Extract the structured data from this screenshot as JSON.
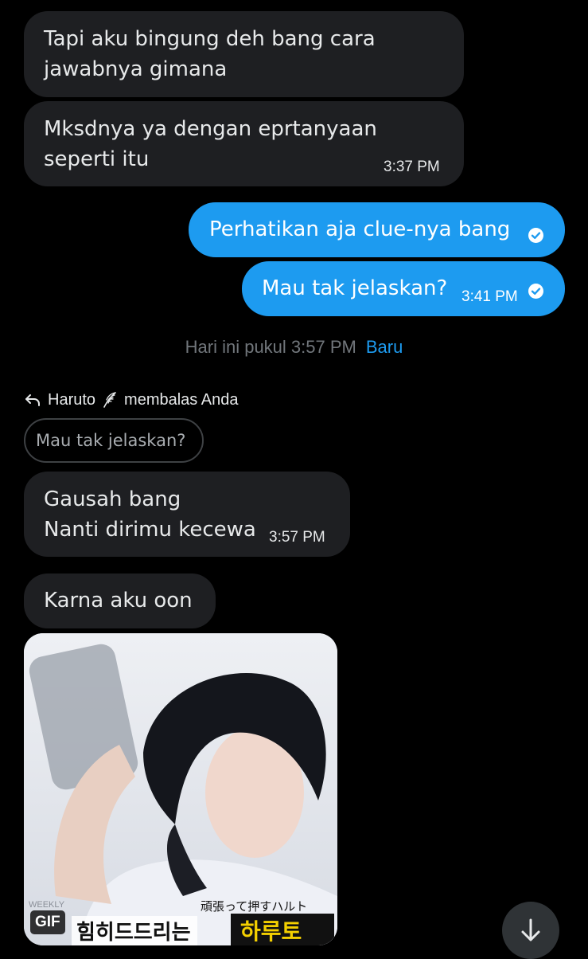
{
  "messages": [
    {
      "direction": "incoming",
      "lines": [
        "Tapi aku bingung deh bang cara",
        "jawabnya gimana"
      ],
      "time": ""
    },
    {
      "direction": "incoming",
      "lines": [
        "Mksdnya ya dengan eprtanyaan",
        "seperti itu"
      ],
      "time": "3:37 PM"
    },
    {
      "direction": "outgoing",
      "lines": [
        "Perhatikan aja clue-nya bang"
      ],
      "time": "",
      "status": "check-icon"
    },
    {
      "direction": "outgoing",
      "lines": [
        "Mau tak jelaskan?"
      ],
      "time": "3:41 PM",
      "status": "check-icon"
    },
    {
      "direction": "incoming",
      "lines": [
        "Gausah bang",
        "Nanti dirimu kecewa"
      ],
      "time": "3:57 PM"
    },
    {
      "direction": "incoming",
      "lines": [
        "Karna aku oon"
      ],
      "time": ""
    }
  ],
  "separator": {
    "text": "Hari ini pukul 3:57 PM",
    "new_label": "Baru"
  },
  "reply": {
    "icon": "reply-arrow-icon",
    "sender": "Haruto",
    "sender_emoji": "feather-emoji-icon",
    "action": "membalas Anda",
    "quoted_text": "Mau tak jelaskan?"
  },
  "gif": {
    "badge": "GIF",
    "caption_jp": "頑張って押すハルト",
    "caption_kr_left": "힘히드드리는",
    "caption_kr_right": "하루토",
    "corner_text": "WEEKLY"
  },
  "scroll_button": {
    "icon": "arrow-down-icon"
  },
  "colors": {
    "background": "#000000",
    "incoming_bubble": "#1e1f22",
    "outgoing_bubble": "#1d9bf0",
    "muted_text": "#71767b",
    "accent": "#1d9bf0"
  }
}
